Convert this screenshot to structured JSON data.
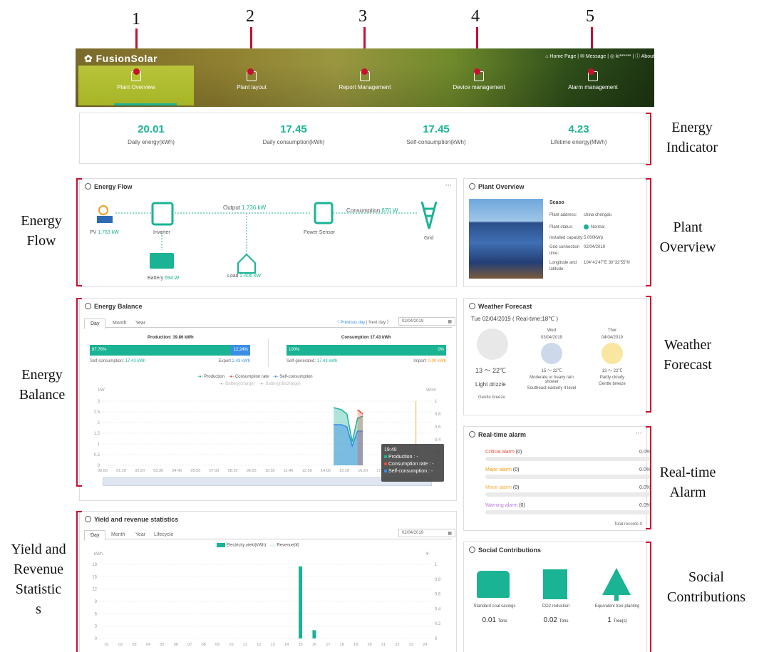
{
  "annotations": {
    "numbers": [
      "1",
      "2",
      "3",
      "4",
      "5"
    ],
    "left": {
      "energy_flow": [
        "Energy",
        "Flow"
      ],
      "energy_balance": [
        "Energy",
        "Balance"
      ],
      "yield": [
        "Yield and",
        "Revenue",
        "Statistic",
        "s"
      ]
    },
    "right": {
      "energy_indicator": [
        "Energy",
        "Indicator"
      ],
      "plant_overview": [
        "Plant",
        "Overview"
      ],
      "weather": [
        "Weather",
        "Forecast"
      ],
      "alarm": [
        "Real-time",
        "Alarm"
      ],
      "social": [
        "Social",
        "Contributions"
      ]
    }
  },
  "header": {
    "logo": "FusionSolar",
    "top_links": "⌂ Home Page | ✉ Message | ◎ ki****** | ⓘ About",
    "nav": [
      "Plant Overview",
      "Plant layout",
      "Report Management",
      "Device management",
      "Alarm management"
    ]
  },
  "kpis": [
    {
      "value": "20.01",
      "label": "Daily energy(kWh)"
    },
    {
      "value": "17.45",
      "label": "Daily consumption(kWh)"
    },
    {
      "value": "17.45",
      "label": "Self-consumption(kWh)"
    },
    {
      "value": "4.23",
      "label": "Lifetime energy(MWh)"
    }
  ],
  "energy_flow": {
    "title": "Energy Flow",
    "pv_label": "PV",
    "pv_value": "1.783 kW",
    "inverter": "Inverter",
    "output_label": "Output",
    "output_value": "1.736 kW",
    "power_sensor": "Power Sensor",
    "consumption_label": "Consumption",
    "consumption_value": "670 W",
    "grid": "Grid",
    "battery_label": "Battery",
    "battery_value": "694 W",
    "load_label": "Load",
    "load_value": "2.406 kW"
  },
  "plant": {
    "title": "Plant Overview",
    "name": "Scaso",
    "rows": [
      {
        "k": "Plant address:",
        "v": "china chengdu"
      },
      {
        "k": "Plant status:",
        "v": "Normal"
      },
      {
        "k": "Installed capacity:",
        "v": "5.000kWp"
      },
      {
        "k": "Grid connection time:",
        "v": "02/04/2019"
      },
      {
        "k": "Longitude and latitude:",
        "v": "104°41'47\"E 30°32'55\"N"
      }
    ]
  },
  "balance": {
    "title": "Energy Balance",
    "tabs": [
      "Day",
      "Month",
      "Year"
    ],
    "prev": "〈 Previous day",
    "next": "Next day 〉",
    "date": "02/04/2019",
    "production_title": "Production: 19.86 kWh",
    "prod_left": "87.76%",
    "prod_right": "12.24%",
    "self_cons": "Self-consumption:",
    "self_cons_v": "17.43 kWh",
    "export": "Export",
    "export_v": "2.43 kWh",
    "consumption_title": "Consumption 17.43 kWh",
    "cons_left": "100%",
    "cons_right": "0%",
    "self_gen": "Self-generated:",
    "self_gen_v": "17.43 kWh",
    "import": "Import:",
    "import_v": "0.00 kWh",
    "legend": [
      "Production",
      "Consumption rate",
      "Self-consumption",
      "Battery(charge)",
      "Battery(discharge)"
    ],
    "y_left": "kW",
    "y_right": "W/m²",
    "tooltip": {
      "time": "19:40",
      "rows": [
        "Production : -",
        "Consumption rate : -",
        "Self-consumption : -"
      ]
    }
  },
  "chart_data": [
    {
      "type": "area",
      "title": "Energy Balance",
      "xlabel": "",
      "ylabel": "kW",
      "categories": [
        "00:00",
        "01:10",
        "02:20",
        "03:30",
        "04:40",
        "05:50",
        "07:00",
        "08:10",
        "09:20",
        "10:30",
        "11:40",
        "12:50",
        "14:00",
        "15:10",
        "16:20",
        "17:30",
        "18:40",
        "19:50"
      ],
      "ylim": [
        0,
        3
      ],
      "y_ticks": [
        "0",
        "0.5",
        "1",
        "1.5",
        "2",
        "2.5",
        "3"
      ],
      "y2_ticks": [
        "0",
        "0.2",
        "0.4",
        "0.6",
        "0.8",
        "1"
      ],
      "series": [
        {
          "name": "Production",
          "x": [
            "14:30",
            "15:00",
            "15:20",
            "15:40",
            "16:00",
            "16:20"
          ],
          "values": [
            2.7,
            2.6,
            2.4,
            1.1,
            2.2,
            2.3
          ]
        },
        {
          "name": "Self-consumption",
          "x": [
            "14:30",
            "15:00",
            "15:20",
            "15:40",
            "16:00",
            "16:20"
          ],
          "values": [
            1.9,
            1.9,
            1.8,
            0.9,
            1.6,
            1.6
          ]
        },
        {
          "name": "Consumption rate",
          "x": [
            "16:00",
            "16:20"
          ],
          "values": [
            2.6,
            2.4
          ]
        }
      ]
    },
    {
      "type": "bar",
      "title": "Yield and revenue statistics",
      "xlabel": "",
      "ylabel": "kWh",
      "categories": [
        "01",
        "02",
        "03",
        "04",
        "05",
        "06",
        "07",
        "08",
        "09",
        "10",
        "11",
        "12",
        "13",
        "14",
        "15",
        "16",
        "17",
        "18",
        "19",
        "20",
        "21",
        "22",
        "23",
        "24"
      ],
      "ylim": [
        0,
        18
      ],
      "y_ticks": [
        "0",
        "3",
        "6",
        "9",
        "12",
        "15",
        "18"
      ],
      "y2_ticks": [
        "0",
        "0.2",
        "0.4",
        "0.6",
        "0.8",
        "1"
      ],
      "series": [
        {
          "name": "Electricity yield(kWh)",
          "values": [
            0,
            0,
            0,
            0,
            0,
            0,
            0,
            0,
            0,
            0,
            0,
            0,
            0,
            0,
            17.5,
            2,
            0,
            0,
            0,
            0,
            0,
            0,
            0,
            0
          ]
        }
      ]
    }
  ],
  "weather": {
    "title": "Weather Forecast",
    "today": "Tue 02/04/2019   ( Real-time:18℃ )",
    "today_temp": "13 ～ 22℃",
    "today_desc": "Light drizzle",
    "today_wind": "Gentle breeze",
    "days": [
      {
        "name": "Wed",
        "date": "03/04/2019",
        "temp": "15 ～ 22℃",
        "desc": "Moderate or heavy rain shower",
        "wind": "Southeast easterly 4 level"
      },
      {
        "name": "Thur",
        "date": "04/04/2019",
        "temp": "13 ～ 22℃",
        "desc": "Partly cloudy",
        "wind": "Gentle breeze"
      }
    ]
  },
  "alarm": {
    "title": "Real-time alarm",
    "rows": [
      {
        "label": "Critical alarm",
        "count": "(0)",
        "pct": "0.0%",
        "color": "#e74c3c"
      },
      {
        "label": "Major alarm",
        "count": "(0)",
        "pct": "0.0%",
        "color": "#f39c12"
      },
      {
        "label": "Minor alarm",
        "count": "(0)",
        "pct": "0.0%",
        "color": "#f5b041"
      },
      {
        "label": "Warning alarm",
        "count": "(0)",
        "pct": "0.0%",
        "color": "#b57edc"
      }
    ],
    "total": "Total records 0"
  },
  "yield": {
    "title": "Yield and revenue statistics",
    "tabs": [
      "Day",
      "Month",
      "Year",
      "Lifecycle"
    ],
    "date": "02/04/2019",
    "legend": [
      "Electricity yield(kWh)",
      "Revenue(¥)"
    ],
    "y_left": "kWh",
    "y_right": "¥"
  },
  "social": {
    "title": "Social Contributions",
    "items": [
      {
        "label": "Standard coal savings",
        "value": "0.01",
        "unit": "Tons"
      },
      {
        "label": "CO2 reduction",
        "value": "0.02",
        "unit": "Tons"
      },
      {
        "label": "Equivalent tree planting",
        "value": "1",
        "unit": "Tree(s)"
      }
    ]
  }
}
